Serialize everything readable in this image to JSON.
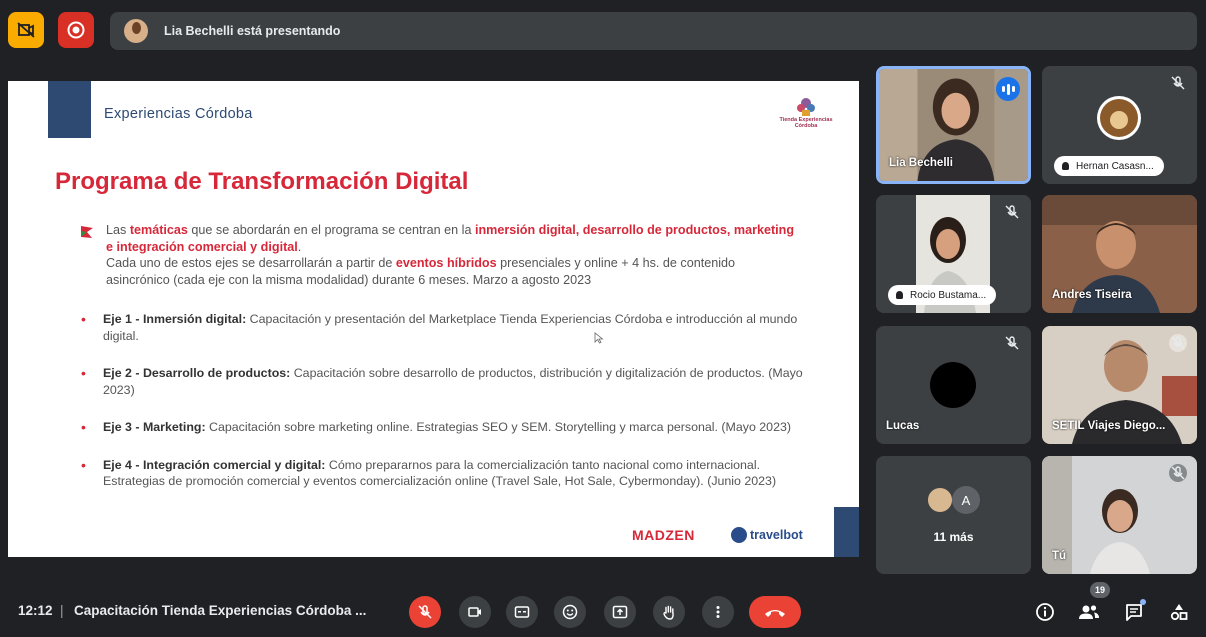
{
  "banner": {
    "presenting_text": "Lia Bechelli está presentando"
  },
  "slide": {
    "brand": "Experiencias Córdoba",
    "logo_text": "Tienda Experiencias Córdoba",
    "title": "Programa de Transformación Digital",
    "intro": {
      "p1_a": "Las ",
      "p1_b": "temáticas",
      "p1_c": " que se abordarán en el programa se centran en la ",
      "p1_d": "inmersión digital, desarrollo de productos, marketing e integración comercial y digital",
      "p1_e": ".",
      "p2_a": "Cada uno de estos ejes se desarrollarán a partir de ",
      "p2_b": "eventos híbridos",
      "p2_c": " presenciales y online + 4 hs. de contenido asincrónico (cada eje con la misma modalidad) durante 6 meses. Marzo a agosto 2023"
    },
    "ejes": [
      {
        "head": "Eje 1 - Inmersión digital:",
        "body": " Capacitación y presentación del Marketplace Tienda Experiencias Córdoba e introducción al mundo digital."
      },
      {
        "head": "Eje 2 - Desarrollo de productos:",
        "body": " Capacitación sobre desarrollo de productos, distribución y digitalización de productos. (Mayo 2023)"
      },
      {
        "head": "Eje 3 - Marketing:",
        "body": " Capacitación sobre marketing online. Estrategias SEO y SEM. Storytelling y marca personal. (Mayo 2023)"
      },
      {
        "head": "Eje 4 - Integración comercial y digital:",
        "body": " Cómo prepararnos para la comercialización tanto nacional como internacional. Estrategias de promoción comercial y eventos comercialización online (Travel Sale, Hot Sale, Cybermonday). (Junio 2023)"
      }
    ],
    "sponsor1": "MADZEN",
    "sponsor2": "travelbot"
  },
  "participants": {
    "lia": "Lia Bechelli",
    "hernan": "Hernan Casasn...",
    "rocio": "Rocio Bustama...",
    "andres": "Andres Tiseira",
    "lucas": "Lucas",
    "setil": "SETIL Viajes Diego...",
    "more_initial": "A",
    "more": "11 más",
    "you": "Tú"
  },
  "bottom": {
    "time": "12:12",
    "separator": "|",
    "meeting_name": "Capacitación Tienda Experiencias Córdoba ...",
    "participant_count": "19"
  },
  "colors": {
    "accent_red": "#d7283a",
    "slide_navy": "#2e4a72",
    "meet_bg": "#202124",
    "tile_bg": "#3c4043",
    "speaker_blue": "#1a73e8",
    "hangup_red": "#ea4335"
  }
}
